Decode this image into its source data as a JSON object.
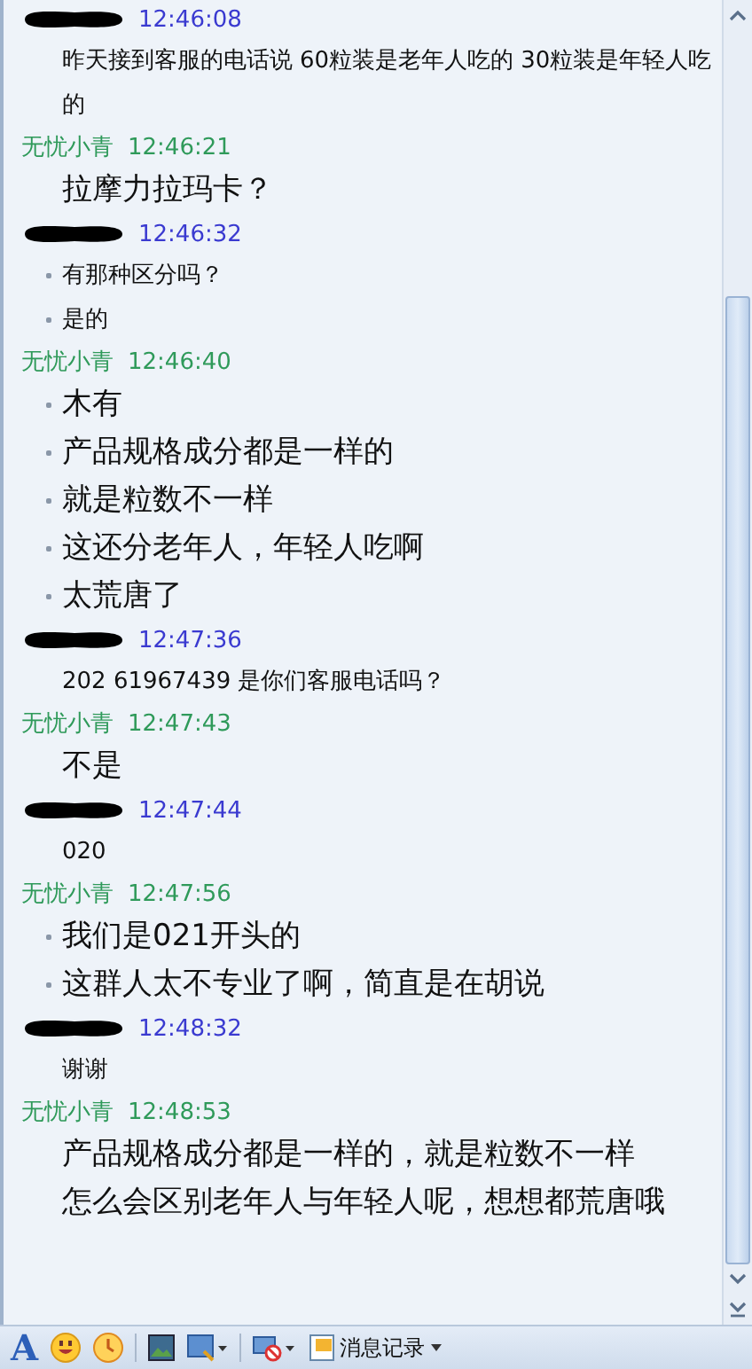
{
  "messages": [
    {
      "sender": {
        "kind": "customer"
      },
      "time": "12:46:08",
      "lines": [
        {
          "text": "昨天接到客服的电话说 60粒装是老年人吃的  30粒装是年轻人吃的",
          "bullet": false
        }
      ]
    },
    {
      "sender": {
        "kind": "agent",
        "name": "无忧小青"
      },
      "time": "12:46:21",
      "lines": [
        {
          "text": "拉摩力拉玛卡？",
          "bullet": false
        }
      ]
    },
    {
      "sender": {
        "kind": "customer"
      },
      "time": "12:46:32",
      "lines": [
        {
          "text": "有那种区分吗？",
          "bullet": true
        },
        {
          "text": "是的",
          "bullet": true
        }
      ]
    },
    {
      "sender": {
        "kind": "agent",
        "name": "无忧小青"
      },
      "time": "12:46:40",
      "lines": [
        {
          "text": "木有",
          "bullet": true
        },
        {
          "text": "产品规格成分都是一样的",
          "bullet": true
        },
        {
          "text": "就是粒数不一样",
          "bullet": true
        },
        {
          "text": "这还分老年人，年轻人吃啊",
          "bullet": true
        },
        {
          "text": "太荒唐了",
          "bullet": true
        }
      ]
    },
    {
      "sender": {
        "kind": "customer"
      },
      "time": "12:47:36",
      "lines": [
        {
          "text": "202  61967439 是你们客服电话吗？",
          "bullet": false
        }
      ]
    },
    {
      "sender": {
        "kind": "agent",
        "name": "无忧小青"
      },
      "time": "12:47:43",
      "lines": [
        {
          "text": "不是",
          "bullet": false
        }
      ]
    },
    {
      "sender": {
        "kind": "customer"
      },
      "time": "12:47:44",
      "lines": [
        {
          "text": "020",
          "bullet": false
        }
      ]
    },
    {
      "sender": {
        "kind": "agent",
        "name": "无忧小青"
      },
      "time": "12:47:56",
      "lines": [
        {
          "text": "我们是021开头的",
          "bullet": true
        },
        {
          "text": "这群人太不专业了啊，简直是在胡说",
          "bullet": true
        }
      ]
    },
    {
      "sender": {
        "kind": "customer"
      },
      "time": "12:48:32",
      "lines": [
        {
          "text": "谢谢",
          "bullet": false
        }
      ]
    },
    {
      "sender": {
        "kind": "agent",
        "name": "无忧小青"
      },
      "time": "12:48:53",
      "lines": [
        {
          "text": "产品规格成分都是一样的，就是粒数不一样",
          "bullet": false
        },
        {
          "text": "怎么会区别老年人与年轻人呢，想想都荒唐哦",
          "bullet": false
        }
      ]
    }
  ],
  "toolbar": {
    "font_button": "A",
    "history_button": "消息记录"
  }
}
